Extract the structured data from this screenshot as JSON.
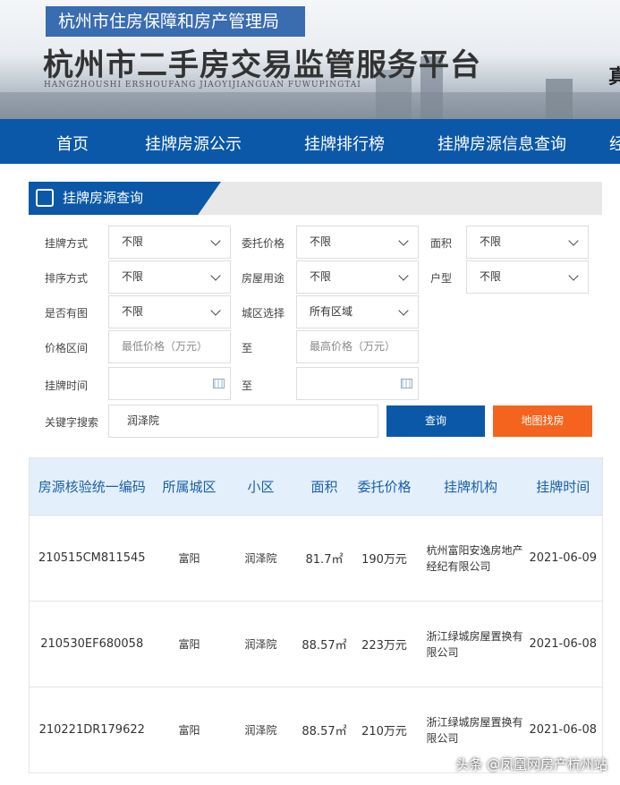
{
  "header": {
    "agency": "杭州市住房保障和房产管理局",
    "title": "杭州市二手房交易监管服务平台",
    "pinyin": "HANGZHOUSHI  ERSHOUFANG  JIAOYIJIANGUAN  FUWUPINGTAI",
    "side_char": "真"
  },
  "nav": [
    "首页",
    "挂牌房源公示",
    "挂牌排行榜",
    "挂牌房源信息查询",
    "经"
  ],
  "panel_title": "挂牌房源查询",
  "form": {
    "listing_method": {
      "label": "挂牌方式",
      "value": "不限"
    },
    "price": {
      "label": "委托价格",
      "value": "不限"
    },
    "area": {
      "label": "面积",
      "value": "不限"
    },
    "sort": {
      "label": "排序方式",
      "value": "不限"
    },
    "usage": {
      "label": "房屋用途",
      "value": "不限"
    },
    "layout": {
      "label": "户型",
      "value": "不限"
    },
    "has_image": {
      "label": "是否有图",
      "value": "不限"
    },
    "district": {
      "label": "城区选择",
      "value": "所有区域"
    },
    "price_range": {
      "label": "价格区间",
      "min_placeholder": "最低价格（万元）",
      "to": "至",
      "max_placeholder": "最高价格（万元）"
    },
    "time": {
      "label": "挂牌时间",
      "to": "至"
    },
    "keyword": {
      "label": "关键字搜索",
      "value": "润泽院"
    },
    "search_button": "查询",
    "map_button": "地图找房"
  },
  "table": {
    "headers": [
      "房源核验统一编码",
      "所属城区",
      "小区",
      "面积",
      "委托价格",
      "挂牌机构",
      "挂牌时间"
    ],
    "rows": [
      [
        "210515CM811545",
        "富阳",
        "润泽院",
        "81.7㎡",
        "190万元",
        "杭州富阳安逸房地产经纪有限公司",
        "2021-06-09"
      ],
      [
        "210530EF680058",
        "富阳",
        "润泽院",
        "88.57㎡",
        "223万元",
        "浙江绿城房屋置换有限公司",
        "2021-06-08"
      ],
      [
        "210221DR179622",
        "富阳",
        "润泽院",
        "88.57㎡",
        "210万元",
        "浙江绿城房屋置换有限公司",
        "2021-06-08"
      ]
    ]
  },
  "watermark": "头条 @凤凰网房产杭州站",
  "colors": {
    "nav": "#0b58a8",
    "orange": "#f5641e",
    "header_bg": "#e3f0fb"
  }
}
